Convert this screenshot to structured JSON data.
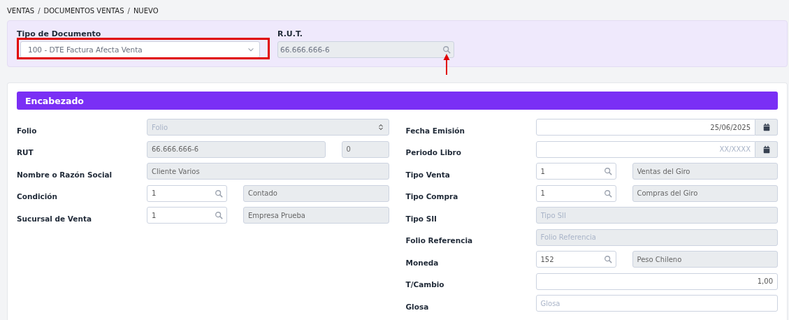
{
  "breadcrumb": {
    "items": [
      "VENTAS",
      "DOCUMENTOS VENTAS",
      "NUEVO"
    ],
    "separator": "/"
  },
  "top_panel": {
    "fields": [
      {
        "label": "Tipo de Documento",
        "kind": "select",
        "value": "100 - DTE Factura Afecta Venta",
        "highlighted": true
      },
      {
        "label": "R.U.T.",
        "kind": "search",
        "value": "66.666.666-6",
        "disabled": true,
        "arrow": true
      }
    ]
  },
  "section": {
    "title": "Encabezado",
    "left": [
      {
        "label": "Folio",
        "fields": [
          {
            "kind": "spinner",
            "placeholder": "Folio",
            "disabled": true
          }
        ]
      },
      {
        "label": "RUT",
        "fields": [
          {
            "kind": "text",
            "value": "66.666.666-6",
            "disabled": true
          },
          {
            "kind": "short",
            "value": "0",
            "disabled": true
          }
        ]
      },
      {
        "label": "Nombre o Razón Social",
        "fields": [
          {
            "kind": "text",
            "value": "Cliente Varios",
            "disabled": true
          }
        ]
      },
      {
        "label": "Condición",
        "fields": [
          {
            "kind": "lookup",
            "value": "1",
            "disabled": false
          },
          {
            "kind": "text",
            "value": "Contado",
            "disabled": true
          }
        ]
      },
      {
        "label": "Sucursal de Venta",
        "fields": [
          {
            "kind": "lookup",
            "value": "1",
            "disabled": false
          },
          {
            "kind": "text",
            "value": "Empresa Prueba",
            "disabled": true
          }
        ]
      }
    ],
    "right": [
      {
        "label": "Fecha Emisión",
        "fields": [
          {
            "kind": "date",
            "value": "25/06/2025",
            "disabled": false
          }
        ]
      },
      {
        "label": "Periodo Libro",
        "fields": [
          {
            "kind": "date",
            "placeholder": "XX/XXXX",
            "disabled": false
          }
        ]
      },
      {
        "label": "Tipo Venta",
        "fields": [
          {
            "kind": "lookup",
            "value": "1",
            "disabled": false
          },
          {
            "kind": "text",
            "value": "Ventas del Giro",
            "disabled": true
          }
        ]
      },
      {
        "label": "Tipo Compra",
        "fields": [
          {
            "kind": "lookup",
            "value": "1",
            "disabled": false
          },
          {
            "kind": "text",
            "value": "Compras del Giro",
            "disabled": true
          }
        ]
      },
      {
        "label": "Tipo SII",
        "fields": [
          {
            "kind": "text",
            "placeholder": "Tipo SII",
            "disabled": true
          }
        ]
      },
      {
        "label": "Folio Referencia",
        "fields": [
          {
            "kind": "text",
            "placeholder": "Folio Referencia",
            "disabled": true
          }
        ]
      },
      {
        "label": "Moneda",
        "fields": [
          {
            "kind": "lookup",
            "value": "152",
            "disabled": false
          },
          {
            "kind": "text",
            "value": "Peso Chileno",
            "disabled": true
          }
        ]
      },
      {
        "label": "T/Cambio",
        "fields": [
          {
            "kind": "amount",
            "value": "1,00",
            "disabled": false
          }
        ]
      },
      {
        "label": "Glosa",
        "fields": [
          {
            "kind": "text",
            "placeholder": "Glosa",
            "disabled": false
          }
        ]
      }
    ]
  }
}
